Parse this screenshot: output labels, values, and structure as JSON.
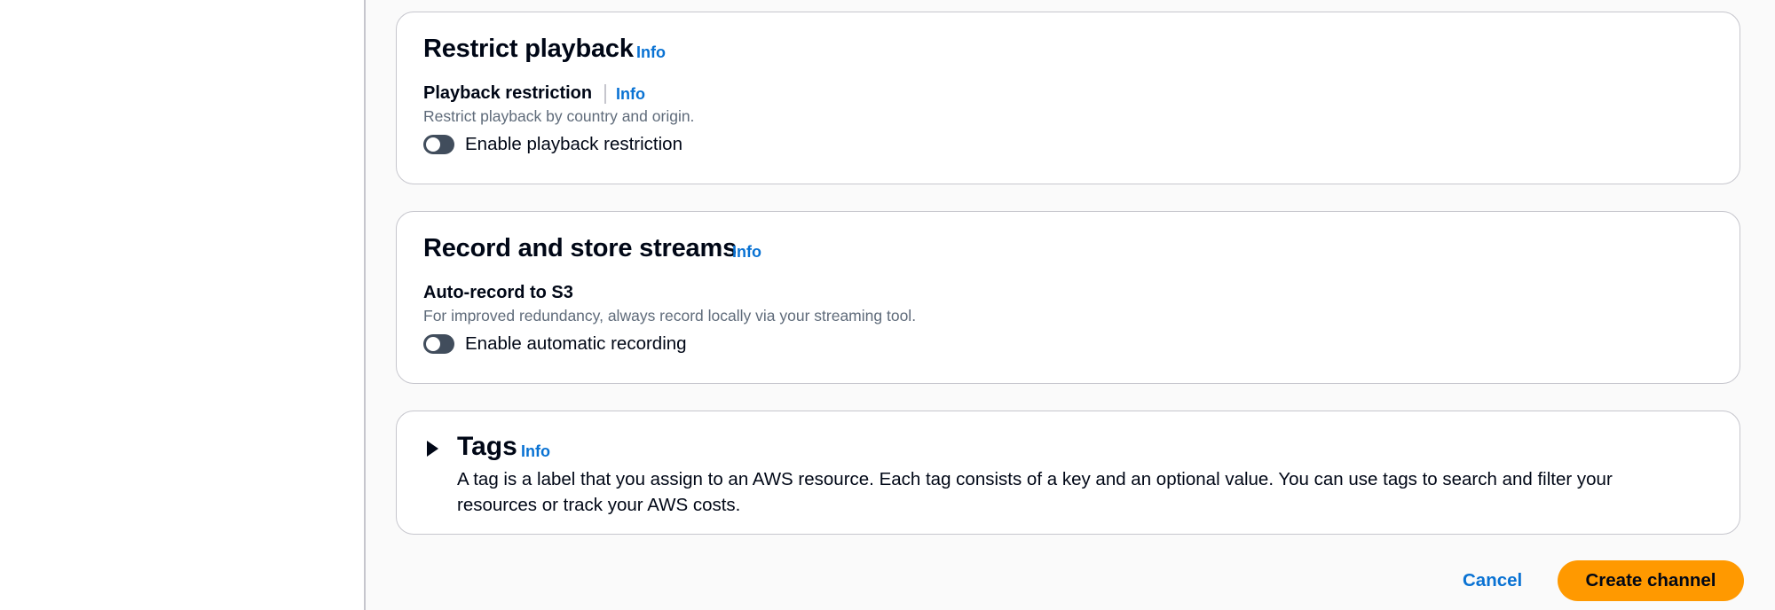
{
  "restrict_playback": {
    "title": "Restrict playback",
    "info": "Info",
    "field_label": "Playback restriction",
    "field_info": "Info",
    "description": "Restrict playback by country and origin.",
    "toggle_label": "Enable playback restriction",
    "toggle_enabled": false
  },
  "record_streams": {
    "title": "Record and store streams",
    "info": "Info",
    "field_label": "Auto-record to S3",
    "description": "For improved redundancy, always record locally via your streaming tool.",
    "toggle_label": "Enable automatic recording",
    "toggle_enabled": false
  },
  "tags": {
    "title": "Tags",
    "info": "Info",
    "expanded": false,
    "description": "A tag is a label that you assign to an AWS resource. Each tag consists of a key and an optional value. You can use tags to search and filter your resources or track your AWS costs."
  },
  "actions": {
    "cancel_label": "Cancel",
    "create_label": "Create channel"
  },
  "colors": {
    "link": "#0972d3",
    "primary_button": "#ff9900",
    "toggle_off": "#414d5c",
    "border": "#c6c6cd"
  },
  "icons": {
    "expand": "caret-right-icon"
  }
}
